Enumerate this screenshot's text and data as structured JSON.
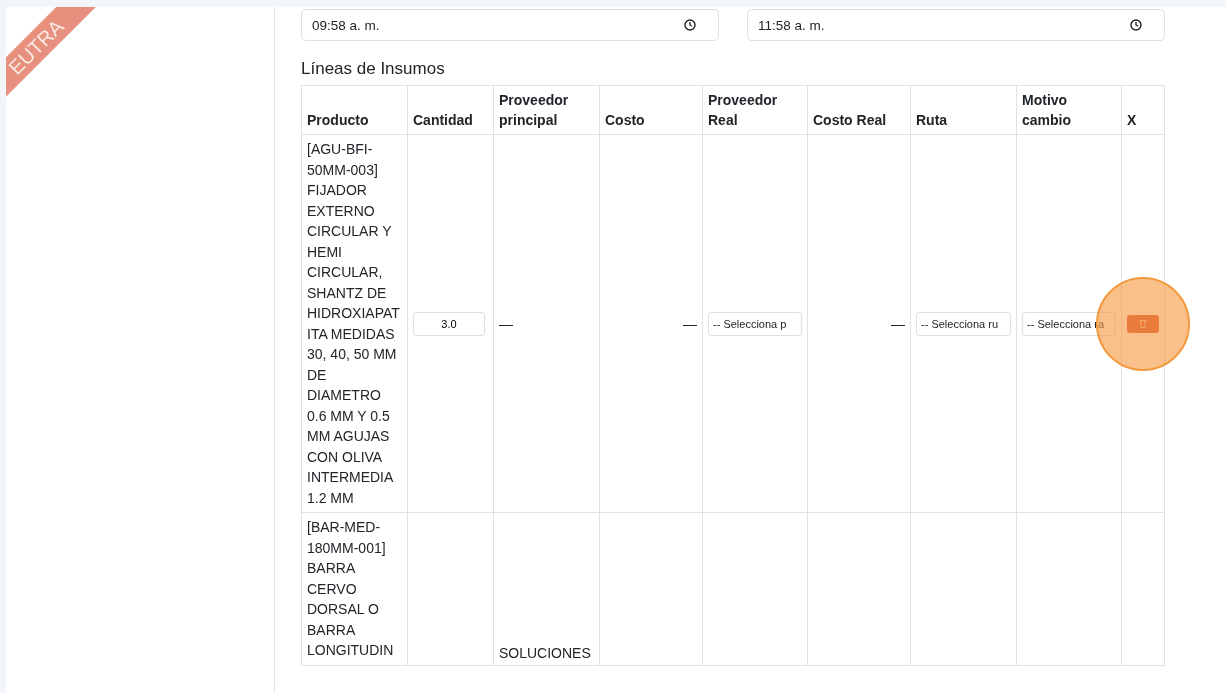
{
  "ribbon": {
    "label": "EUTRA"
  },
  "times": [
    {
      "value": "09:58 a. m."
    },
    {
      "value": "11:58 a. m."
    }
  ],
  "section_title": "Líneas de Insumos",
  "table": {
    "columns": [
      "Producto",
      "Cantidad",
      "Proveedor principal",
      "Costo",
      "Proveedor Real",
      "Costo Real",
      "Ruta",
      "Motivo cambio",
      "X"
    ],
    "rows": [
      {
        "producto": "[AGU-BFI-50MM-003] FIJADOR EXTERNO CIRCULAR Y HEMI CIRCULAR, SHANTZ DE HIDROXIAPATITA MEDIDAS 30, 40, 50 MM DE DIAMETRO 0.6 MM Y 0.5 MM AGUJAS CON OLIVA INTERMEDIA 1.2 MM",
        "cantidad": "3.0",
        "proveedor_principal": "—",
        "costo": "—",
        "proveedor_real": "-- Selecciona p",
        "costo_real": "—",
        "ruta": "-- Selecciona ru",
        "motivo": "-- Selecciona ra",
        "highlighted": true
      },
      {
        "producto": "[BAR-MED-180MM-001] BARRA CERVO DORSAL O BARRA LONGITUDIN",
        "proveedor_principal": "SOLUCIONES",
        "highlighted": false
      }
    ]
  }
}
